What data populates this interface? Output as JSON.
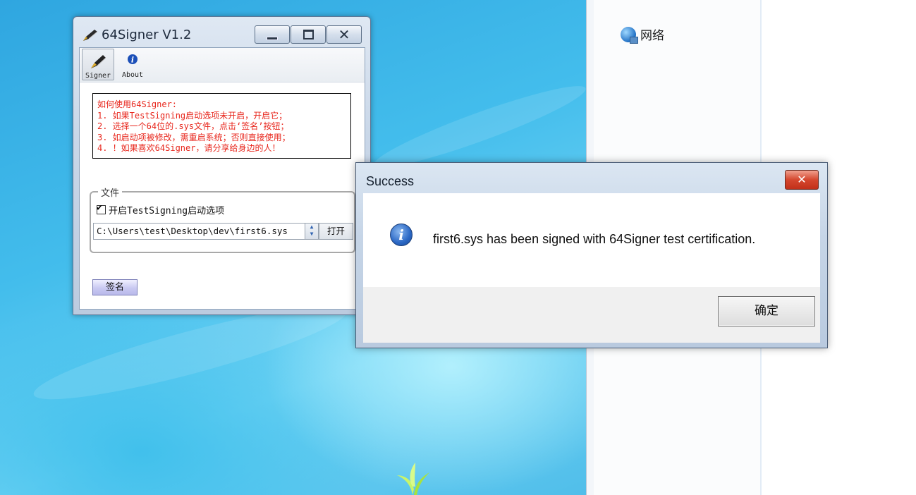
{
  "desktop": {
    "explorer": {
      "network_label": "网络"
    }
  },
  "signer_window": {
    "title": "64Signer V1.2",
    "toolbar": {
      "signer_label": "Signer",
      "about_label": "About"
    },
    "instructions": [
      "如何使用64Signer:",
      "1. 如果TestSigning启动选项未开启，开启它；",
      "2. 选择一个64位的.sys文件，点击‘签名’按钮；",
      "3. 如启动项被修改，需重启系统；否则直接使用；",
      "4. ！如果喜欢64Signer，请分享给身边的人！"
    ],
    "file_group": {
      "legend": "文件",
      "testsigning_label": "开启TestSigning启动选项",
      "testsigning_checked": true,
      "path_value": "C:\\Users\\test\\Desktop\\dev\\first6.sys",
      "open_label": "打开"
    },
    "sign_label": "签名"
  },
  "message_box": {
    "title": "Success",
    "message": "first6.sys has been signed with 64Signer test certification.",
    "icon": "info-icon",
    "ok_label": "确定"
  },
  "colors": {
    "instruction_text": "#e8261c",
    "close_button": "#c2301a",
    "sign_button": "#c9c9f2"
  }
}
